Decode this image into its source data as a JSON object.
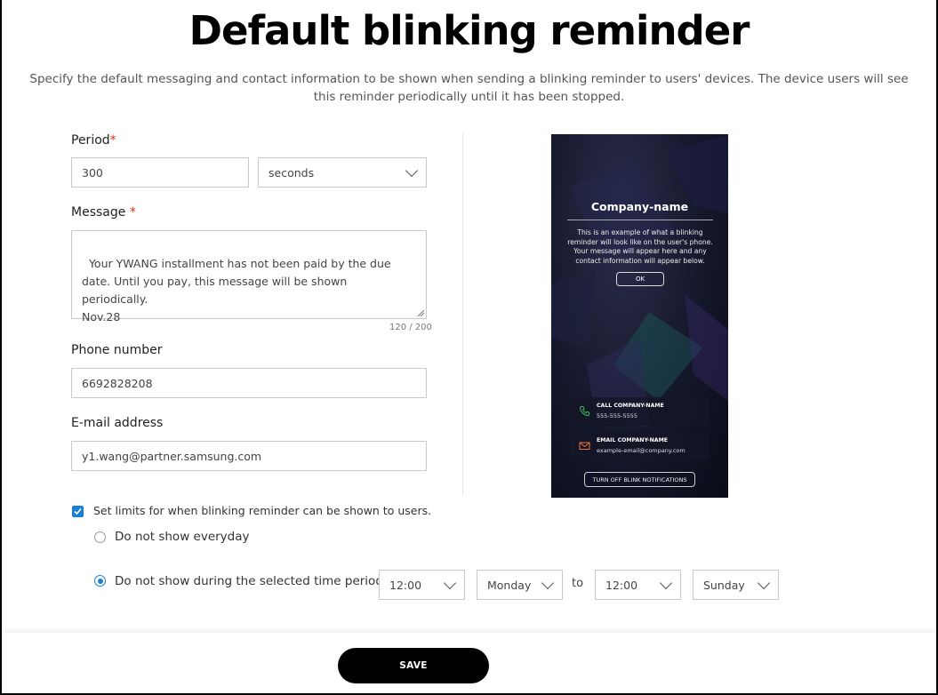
{
  "page": {
    "title": "Default blinking reminder",
    "description": "Specify the default messaging and contact information to be shown when sending a blinking reminder to users' devices. The device users will see this reminder periodically until it has been stopped."
  },
  "form": {
    "period": {
      "label": "Period",
      "required_mark": "*",
      "value": "300",
      "unit": "seconds"
    },
    "message": {
      "label": "Message",
      "required_mark": "*",
      "value": "Your YWANG installment has not been paid by the due date. Until you pay, this message will be shown periodically.\nNov.28",
      "counter": "120 / 200"
    },
    "phone": {
      "label": "Phone number",
      "value": "6692828208"
    },
    "email": {
      "label": "E-mail address",
      "value": "y1.wang@partner.samsung.com"
    }
  },
  "preview": {
    "company": "Company-name",
    "text": "This is an example of what a blinking reminder will look like on the user's phone. Your message will appear here and any contact information will appear below.",
    "ok_label": "OK",
    "call_title": "CALL COMPANY-NAME",
    "call_value": "555-555-5555",
    "email_title": "EMAIL COMPANY-NAME",
    "email_value": "example-email@company.com",
    "turn_off_label": "TURN OFF BLINK NOTIFICATIONS",
    "accent_call": "#3bbf5a",
    "accent_email": "#e8763a"
  },
  "limits": {
    "checkbox_label": "Set limits for when blinking reminder can be shown to users.",
    "checked": true,
    "option_everyday": "Do not show everyday",
    "option_period": "Do not show during the selected time period of",
    "selected_option": "period",
    "start_time": "12:00",
    "start_day": "Monday",
    "to_label": "to",
    "end_time": "12:00",
    "end_day": "Sunday"
  },
  "footer": {
    "save_label": "SAVE"
  },
  "colors": {
    "accent": "#1c7fd6",
    "required": "#e0321c",
    "save_bg": "#000000"
  }
}
